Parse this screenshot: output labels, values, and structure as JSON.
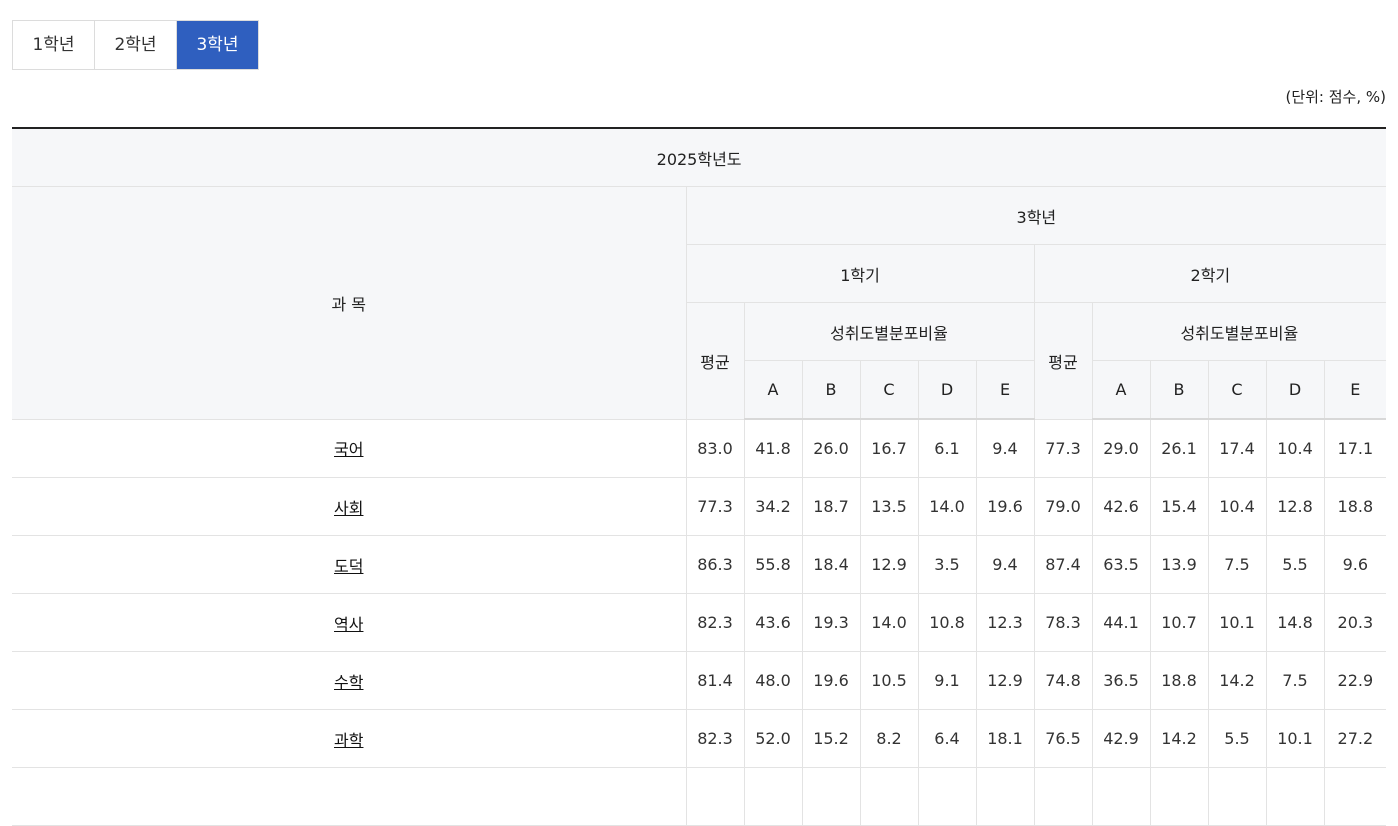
{
  "tabs": [
    {
      "label": "1학년",
      "active": false
    },
    {
      "label": "2학년",
      "active": false
    },
    {
      "label": "3학년",
      "active": true
    }
  ],
  "unit_note": "(단위: 점수, %)",
  "table": {
    "year_header": "2025학년도",
    "subject_header": "과 목",
    "grade_header": "3학년",
    "semesters": [
      "1학기",
      "2학기"
    ],
    "avg_label": "평균",
    "dist_label": "성취도별분포비율",
    "levels": [
      "A",
      "B",
      "C",
      "D",
      "E"
    ],
    "rows": [
      {
        "subject": "국어",
        "values": [
          "83.0",
          "41.8",
          "26.0",
          "16.7",
          "6.1",
          "9.4",
          "77.3",
          "29.0",
          "26.1",
          "17.4",
          "10.4",
          "17.1"
        ]
      },
      {
        "subject": "사회",
        "values": [
          "77.3",
          "34.2",
          "18.7",
          "13.5",
          "14.0",
          "19.6",
          "79.0",
          "42.6",
          "15.4",
          "10.4",
          "12.8",
          "18.8"
        ]
      },
      {
        "subject": "도덕",
        "values": [
          "86.3",
          "55.8",
          "18.4",
          "12.9",
          "3.5",
          "9.4",
          "87.4",
          "63.5",
          "13.9",
          "7.5",
          "5.5",
          "9.6"
        ]
      },
      {
        "subject": "역사",
        "values": [
          "82.3",
          "43.6",
          "19.3",
          "14.0",
          "10.8",
          "12.3",
          "78.3",
          "44.1",
          "10.7",
          "10.1",
          "14.8",
          "20.3"
        ]
      },
      {
        "subject": "수학",
        "values": [
          "81.4",
          "48.0",
          "19.6",
          "10.5",
          "9.1",
          "12.9",
          "74.8",
          "36.5",
          "18.8",
          "14.2",
          "7.5",
          "22.9"
        ]
      },
      {
        "subject": "과학",
        "values": [
          "82.3",
          "52.0",
          "15.2",
          "8.2",
          "6.4",
          "18.1",
          "76.5",
          "42.9",
          "14.2",
          "5.5",
          "10.1",
          "27.2"
        ]
      },
      {
        "subject": "",
        "values": [
          "",
          "",
          "",
          "",
          "",
          "",
          "",
          "",
          "",
          "",
          "",
          ""
        ]
      }
    ]
  }
}
